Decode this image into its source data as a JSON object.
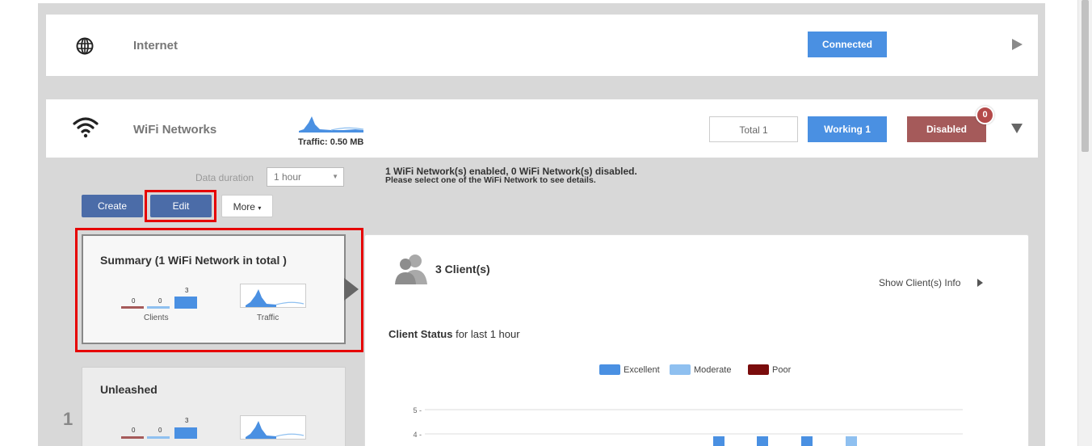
{
  "internet": {
    "title": "Internet",
    "icon": "globe-icon",
    "status": "Connected"
  },
  "wifi": {
    "title": "WiFi Networks",
    "icon": "wifi-icon",
    "traffic_label": "Traffic: 0.50 MB",
    "total": "Total 1",
    "working": "Working 1",
    "disabled": "Disabled",
    "disabled_count": "0"
  },
  "controls": {
    "duration_label": "Data duration",
    "duration_value": "1 hour",
    "create": "Create",
    "edit": "Edit",
    "more": "More"
  },
  "message": {
    "line1": "1 WiFi Network(s) enabled, 0 WiFi Network(s) disabled.",
    "line2": "Please select one of the WiFi Network to see details."
  },
  "summary": {
    "title": "Summary (1 WiFi Network in total )",
    "poor": "0",
    "moderate": "0",
    "excellent": "3",
    "clients_caption": "Clients",
    "traffic_caption": "Traffic"
  },
  "unleashed": {
    "title": "Unleashed",
    "index": "1",
    "poor": "0",
    "moderate": "0",
    "excellent": "3"
  },
  "details": {
    "clients": "3 Client(s)",
    "show_info": "Show Client(s) Info",
    "status_title": "Client Status",
    "status_suffix": " for last 1 hour",
    "legend": [
      {
        "label": "Excellent",
        "color": "#4a90e2"
      },
      {
        "label": "Moderate",
        "color": "#8fc0f0"
      },
      {
        "label": "Poor",
        "color": "#7a0c0c"
      }
    ]
  },
  "chart_data": {
    "type": "bar",
    "title": "",
    "ytick_labels": [
      "5 -",
      "4 -"
    ],
    "series": [
      {
        "name": "Excellent",
        "color": "#4a90e2"
      },
      {
        "name": "Moderate",
        "color": "#8fc0f0"
      },
      {
        "name": "Poor",
        "color": "#7a0c0c"
      }
    ]
  },
  "colors": {
    "accent": "#4a90e2",
    "disabled": "#a55a5a",
    "highlight": "#e60000"
  }
}
